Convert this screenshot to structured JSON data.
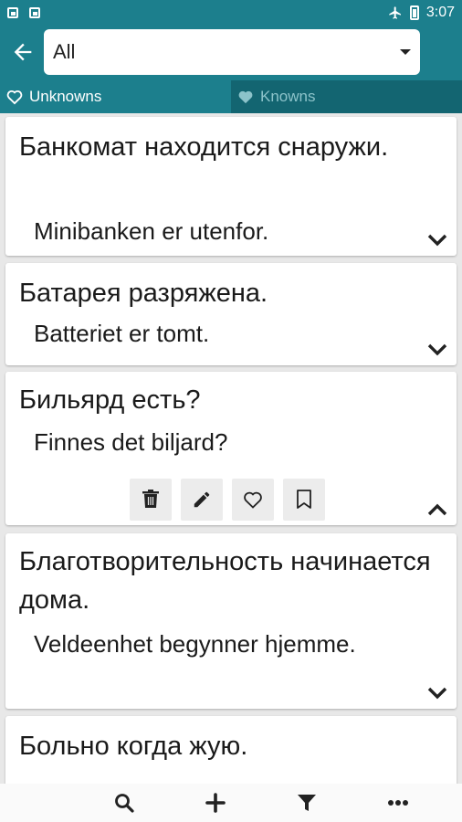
{
  "status_bar": {
    "time": "3:07"
  },
  "app_bar": {
    "category_selected": "All"
  },
  "tabs": [
    {
      "label": "Unknowns",
      "active": true
    },
    {
      "label": "Knowns",
      "active": false
    }
  ],
  "cards": [
    {
      "ru": "Банкомат находится снаружи.",
      "no": "Minibanken er utenfor.",
      "expanded": false
    },
    {
      "ru": "Батарея разряжена.",
      "no": "Batteriet er tomt.",
      "expanded": false
    },
    {
      "ru": "Бильярд есть?",
      "no": "Finnes det biljard?",
      "expanded": true
    },
    {
      "ru": "Благотворительность начинается дома.",
      "no": "Veldeenhet begynner hjemme.",
      "expanded": false
    },
    {
      "ru": "Больно когда жую.",
      "no": "",
      "expanded": false
    }
  ],
  "icons": {
    "back": "arrow-left-icon",
    "delete": "trash-icon",
    "edit": "pencil-icon",
    "favorite": "heart-icon",
    "bookmark": "bookmark-icon",
    "search": "search-icon",
    "add": "plus-icon",
    "filter": "filter-icon",
    "more": "more-icon"
  },
  "colors": {
    "accent": "#1c7f8d",
    "accent_dark": "#136571"
  }
}
